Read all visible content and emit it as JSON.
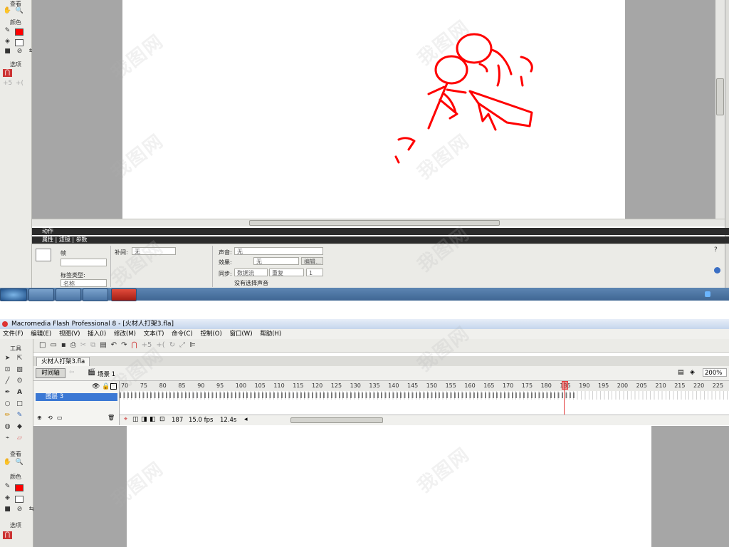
{
  "top": {
    "tools": {
      "view_label": "查看",
      "colors_label": "颜色",
      "options_label": "选项"
    },
    "panels": {
      "actions_tab": "动作",
      "properties_tab": "属性",
      "filters_tab": "滤镜",
      "params_tab": "参数"
    },
    "props": {
      "frame_label": "帧",
      "tween_label": "补间:",
      "tween_value": "无",
      "label_type_label": "标签类型:",
      "label_type_value": "名称",
      "sound_label": "声音:",
      "sound_value": "无",
      "effect_label": "效果:",
      "effect_value": "无",
      "edit_button": "编辑...",
      "sync_label": "同步:",
      "sync_value": "数据流",
      "repeat_value": "重复",
      "repeat_count": "1",
      "no_sound_text": "没有选择声音"
    }
  },
  "bottom": {
    "title": "Macromedia Flash Professional 8 - [火材人打架3.fla]",
    "menu": [
      "文件(F)",
      "编辑(E)",
      "视图(V)",
      "插入(I)",
      "修改(M)",
      "文本(T)",
      "命令(C)",
      "控制(O)",
      "窗口(W)",
      "帮助(H)"
    ],
    "tools_label": "工具",
    "view_label": "查看",
    "colors_label": "颜色",
    "options_label": "选项",
    "doc_tab": "火材人打架3.fla",
    "timeline_button": "时间轴",
    "scene": "场景 1",
    "zoom": "200%",
    "layer_name": "图层 3",
    "ruler_numbers": [
      "70",
      "75",
      "80",
      "85",
      "90",
      "95",
      "100",
      "105",
      "110",
      "115",
      "120",
      "125",
      "130",
      "135",
      "140",
      "145",
      "150",
      "155",
      "160",
      "165",
      "170",
      "175",
      "180",
      "185",
      "190",
      "195",
      "200",
      "205",
      "210",
      "215",
      "220",
      "225"
    ],
    "current_frame": "187",
    "fps": "15.0 fps",
    "elapsed": "12.4s"
  },
  "watermark": "我图网",
  "colors": {
    "stroke": "#ff0000",
    "playhead": "#e23a3a",
    "selection": "#3b78d4"
  }
}
